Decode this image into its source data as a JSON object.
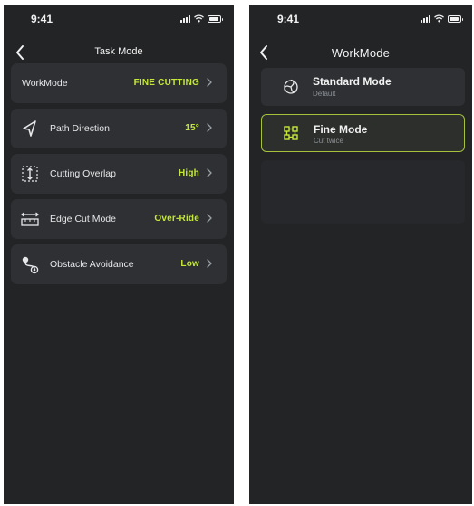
{
  "colors": {
    "accent": "#c6e83a",
    "background": "#222426",
    "card": "#2e3033"
  },
  "left_screen": {
    "status_time": "9:41",
    "title": "Task Mode",
    "rows": [
      {
        "label": "WorkMode",
        "value": "FINE CUTTING",
        "icon": "none"
      },
      {
        "label": "Path Direction",
        "value": "15°",
        "icon": "direction-arrow-icon"
      },
      {
        "label": "Cutting Overlap",
        "value": "High",
        "icon": "overlap-icon"
      },
      {
        "label": "Edge Cut Mode",
        "value": "Over-Ride",
        "icon": "edge-cut-icon"
      },
      {
        "label": "Obstacle Avoidance",
        "value": "Low",
        "icon": "obstacle-icon"
      }
    ]
  },
  "right_screen": {
    "status_time": "9:41",
    "title": "WorkMode",
    "modes": [
      {
        "title": "Standard Mode",
        "subtitle": "Default",
        "icon": "standard-mode-icon",
        "selected": false
      },
      {
        "title": "Fine Mode",
        "subtitle": "Cut twice",
        "icon": "fine-mode-icon",
        "selected": true
      }
    ]
  }
}
